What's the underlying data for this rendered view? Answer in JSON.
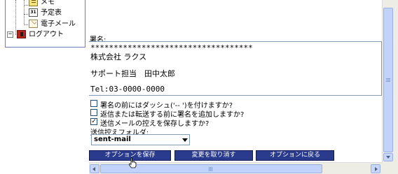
{
  "sidebar": {
    "items": [
      {
        "label": "メモ",
        "icon": "memo-icon"
      },
      {
        "label": "予定表",
        "icon": "calendar-icon",
        "icon_text": "31"
      },
      {
        "label": "電子メール",
        "icon": "mail-icon"
      },
      {
        "label": "ログアウト",
        "icon": "logout-icon",
        "expander": "−"
      }
    ]
  },
  "signature": {
    "label": "署名:",
    "lines": [
      "***********************************",
      "株式会社 ラクス",
      "サポート担当　田中太郎",
      "Tel:03-0000-0000"
    ]
  },
  "options": [
    {
      "label": "署名の前にはダッシュ('-- ')を付けますか?",
      "checked": false
    },
    {
      "label": "返信または転送する前に署名を追加しますか?",
      "checked": false
    },
    {
      "label": "送信メールの控えを保存しますか?",
      "checked": true
    }
  ],
  "sent_folder": {
    "label": "送信控えフォルダ:",
    "selected": "sent-mail"
  },
  "buttons": {
    "save": "オプションを保存",
    "cancel": "変更を取り消す",
    "back": "オプションに戻る"
  },
  "colors": {
    "button_bg": "#2a3a8c",
    "sidebar_border": "#6b7fc0",
    "scrollbar_thumb": "#c1d3fb"
  }
}
